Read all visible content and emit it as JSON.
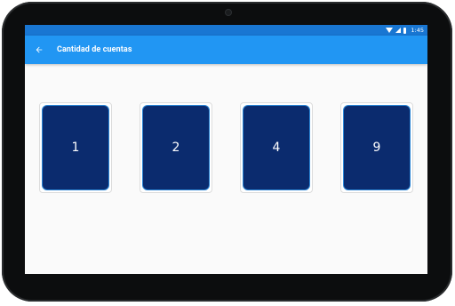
{
  "status_bar": {
    "time": "1:45",
    "icons": [
      "wifi-icon",
      "signal-icon",
      "battery-icon"
    ],
    "color": "#1976d2"
  },
  "app_bar": {
    "title": "Cantidad de cuentas",
    "back_icon": "arrow-back-icon",
    "color": "#2196f3"
  },
  "cards": [
    {
      "label": "1"
    },
    {
      "label": "2"
    },
    {
      "label": "4"
    },
    {
      "label": "9"
    }
  ],
  "colors": {
    "card_face": "#0b2b6e",
    "card_border": "#2a86d6",
    "background": "#fafafa"
  }
}
